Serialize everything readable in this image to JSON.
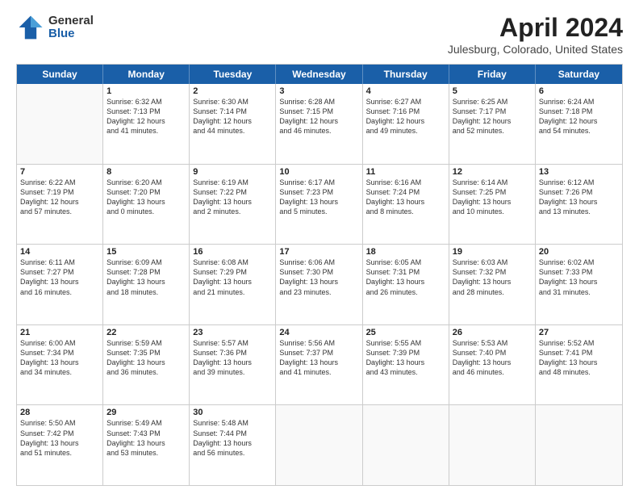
{
  "header": {
    "logo_general": "General",
    "logo_blue": "Blue",
    "title": "April 2024",
    "subtitle": "Julesburg, Colorado, United States"
  },
  "calendar": {
    "days": [
      "Sunday",
      "Monday",
      "Tuesday",
      "Wednesday",
      "Thursday",
      "Friday",
      "Saturday"
    ],
    "rows": [
      [
        {
          "day": "",
          "empty": true
        },
        {
          "day": "1",
          "line1": "Sunrise: 6:32 AM",
          "line2": "Sunset: 7:13 PM",
          "line3": "Daylight: 12 hours",
          "line4": "and 41 minutes."
        },
        {
          "day": "2",
          "line1": "Sunrise: 6:30 AM",
          "line2": "Sunset: 7:14 PM",
          "line3": "Daylight: 12 hours",
          "line4": "and 44 minutes."
        },
        {
          "day": "3",
          "line1": "Sunrise: 6:28 AM",
          "line2": "Sunset: 7:15 PM",
          "line3": "Daylight: 12 hours",
          "line4": "and 46 minutes."
        },
        {
          "day": "4",
          "line1": "Sunrise: 6:27 AM",
          "line2": "Sunset: 7:16 PM",
          "line3": "Daylight: 12 hours",
          "line4": "and 49 minutes."
        },
        {
          "day": "5",
          "line1": "Sunrise: 6:25 AM",
          "line2": "Sunset: 7:17 PM",
          "line3": "Daylight: 12 hours",
          "line4": "and 52 minutes."
        },
        {
          "day": "6",
          "line1": "Sunrise: 6:24 AM",
          "line2": "Sunset: 7:18 PM",
          "line3": "Daylight: 12 hours",
          "line4": "and 54 minutes."
        }
      ],
      [
        {
          "day": "7",
          "line1": "Sunrise: 6:22 AM",
          "line2": "Sunset: 7:19 PM",
          "line3": "Daylight: 12 hours",
          "line4": "and 57 minutes."
        },
        {
          "day": "8",
          "line1": "Sunrise: 6:20 AM",
          "line2": "Sunset: 7:20 PM",
          "line3": "Daylight: 13 hours",
          "line4": "and 0 minutes."
        },
        {
          "day": "9",
          "line1": "Sunrise: 6:19 AM",
          "line2": "Sunset: 7:22 PM",
          "line3": "Daylight: 13 hours",
          "line4": "and 2 minutes."
        },
        {
          "day": "10",
          "line1": "Sunrise: 6:17 AM",
          "line2": "Sunset: 7:23 PM",
          "line3": "Daylight: 13 hours",
          "line4": "and 5 minutes."
        },
        {
          "day": "11",
          "line1": "Sunrise: 6:16 AM",
          "line2": "Sunset: 7:24 PM",
          "line3": "Daylight: 13 hours",
          "line4": "and 8 minutes."
        },
        {
          "day": "12",
          "line1": "Sunrise: 6:14 AM",
          "line2": "Sunset: 7:25 PM",
          "line3": "Daylight: 13 hours",
          "line4": "and 10 minutes."
        },
        {
          "day": "13",
          "line1": "Sunrise: 6:12 AM",
          "line2": "Sunset: 7:26 PM",
          "line3": "Daylight: 13 hours",
          "line4": "and 13 minutes."
        }
      ],
      [
        {
          "day": "14",
          "line1": "Sunrise: 6:11 AM",
          "line2": "Sunset: 7:27 PM",
          "line3": "Daylight: 13 hours",
          "line4": "and 16 minutes."
        },
        {
          "day": "15",
          "line1": "Sunrise: 6:09 AM",
          "line2": "Sunset: 7:28 PM",
          "line3": "Daylight: 13 hours",
          "line4": "and 18 minutes."
        },
        {
          "day": "16",
          "line1": "Sunrise: 6:08 AM",
          "line2": "Sunset: 7:29 PM",
          "line3": "Daylight: 13 hours",
          "line4": "and 21 minutes."
        },
        {
          "day": "17",
          "line1": "Sunrise: 6:06 AM",
          "line2": "Sunset: 7:30 PM",
          "line3": "Daylight: 13 hours",
          "line4": "and 23 minutes."
        },
        {
          "day": "18",
          "line1": "Sunrise: 6:05 AM",
          "line2": "Sunset: 7:31 PM",
          "line3": "Daylight: 13 hours",
          "line4": "and 26 minutes."
        },
        {
          "day": "19",
          "line1": "Sunrise: 6:03 AM",
          "line2": "Sunset: 7:32 PM",
          "line3": "Daylight: 13 hours",
          "line4": "and 28 minutes."
        },
        {
          "day": "20",
          "line1": "Sunrise: 6:02 AM",
          "line2": "Sunset: 7:33 PM",
          "line3": "Daylight: 13 hours",
          "line4": "and 31 minutes."
        }
      ],
      [
        {
          "day": "21",
          "line1": "Sunrise: 6:00 AM",
          "line2": "Sunset: 7:34 PM",
          "line3": "Daylight: 13 hours",
          "line4": "and 34 minutes."
        },
        {
          "day": "22",
          "line1": "Sunrise: 5:59 AM",
          "line2": "Sunset: 7:35 PM",
          "line3": "Daylight: 13 hours",
          "line4": "and 36 minutes."
        },
        {
          "day": "23",
          "line1": "Sunrise: 5:57 AM",
          "line2": "Sunset: 7:36 PM",
          "line3": "Daylight: 13 hours",
          "line4": "and 39 minutes."
        },
        {
          "day": "24",
          "line1": "Sunrise: 5:56 AM",
          "line2": "Sunset: 7:37 PM",
          "line3": "Daylight: 13 hours",
          "line4": "and 41 minutes."
        },
        {
          "day": "25",
          "line1": "Sunrise: 5:55 AM",
          "line2": "Sunset: 7:39 PM",
          "line3": "Daylight: 13 hours",
          "line4": "and 43 minutes."
        },
        {
          "day": "26",
          "line1": "Sunrise: 5:53 AM",
          "line2": "Sunset: 7:40 PM",
          "line3": "Daylight: 13 hours",
          "line4": "and 46 minutes."
        },
        {
          "day": "27",
          "line1": "Sunrise: 5:52 AM",
          "line2": "Sunset: 7:41 PM",
          "line3": "Daylight: 13 hours",
          "line4": "and 48 minutes."
        }
      ],
      [
        {
          "day": "28",
          "line1": "Sunrise: 5:50 AM",
          "line2": "Sunset: 7:42 PM",
          "line3": "Daylight: 13 hours",
          "line4": "and 51 minutes."
        },
        {
          "day": "29",
          "line1": "Sunrise: 5:49 AM",
          "line2": "Sunset: 7:43 PM",
          "line3": "Daylight: 13 hours",
          "line4": "and 53 minutes."
        },
        {
          "day": "30",
          "line1": "Sunrise: 5:48 AM",
          "line2": "Sunset: 7:44 PM",
          "line3": "Daylight: 13 hours",
          "line4": "and 56 minutes."
        },
        {
          "day": "",
          "empty": true
        },
        {
          "day": "",
          "empty": true
        },
        {
          "day": "",
          "empty": true
        },
        {
          "day": "",
          "empty": true
        }
      ]
    ]
  }
}
